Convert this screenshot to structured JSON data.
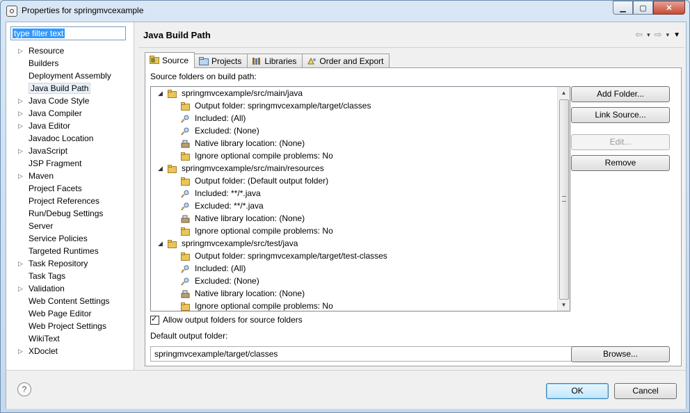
{
  "window": {
    "title": "Properties for springmvcexample",
    "minimize": "▁",
    "maximize": "▢",
    "close": "✕"
  },
  "filter": {
    "value": "type filter text"
  },
  "tree": [
    {
      "label": "Resource",
      "expandable": true
    },
    {
      "label": "Builders",
      "expandable": false
    },
    {
      "label": "Deployment Assembly",
      "expandable": false
    },
    {
      "label": "Java Build Path",
      "expandable": false,
      "selected": true
    },
    {
      "label": "Java Code Style",
      "expandable": true
    },
    {
      "label": "Java Compiler",
      "expandable": true
    },
    {
      "label": "Java Editor",
      "expandable": true
    },
    {
      "label": "Javadoc Location",
      "expandable": false
    },
    {
      "label": "JavaScript",
      "expandable": true
    },
    {
      "label": "JSP Fragment",
      "expandable": false
    },
    {
      "label": "Maven",
      "expandable": true
    },
    {
      "label": "Project Facets",
      "expandable": false
    },
    {
      "label": "Project References",
      "expandable": false
    },
    {
      "label": "Run/Debug Settings",
      "expandable": false
    },
    {
      "label": "Server",
      "expandable": false
    },
    {
      "label": "Service Policies",
      "expandable": false
    },
    {
      "label": "Targeted Runtimes",
      "expandable": false
    },
    {
      "label": "Task Repository",
      "expandable": true
    },
    {
      "label": "Task Tags",
      "expandable": false
    },
    {
      "label": "Validation",
      "expandable": true
    },
    {
      "label": "Web Content Settings",
      "expandable": false
    },
    {
      "label": "Web Page Editor",
      "expandable": false
    },
    {
      "label": "Web Project Settings",
      "expandable": false
    },
    {
      "label": "WikiText",
      "expandable": false
    },
    {
      "label": "XDoclet",
      "expandable": true
    }
  ],
  "page": {
    "title": "Java Build Path",
    "nav": {
      "back": "⇦",
      "forward": "⇨",
      "dropdown": "▾",
      "menu": "▼"
    }
  },
  "tabs": [
    {
      "label": "Source",
      "icon": "source-folder-icon",
      "active": true
    },
    {
      "label": "Projects",
      "icon": "projects-icon",
      "active": false
    },
    {
      "label": "Libraries",
      "icon": "libraries-icon",
      "active": false
    },
    {
      "label": "Order and Export",
      "icon": "order-export-icon",
      "active": false
    }
  ],
  "source": {
    "section_label": "Source folders on build path:",
    "rows": [
      {
        "level": 0,
        "icon": "folder",
        "text": "springmvcexample/src/main/java"
      },
      {
        "level": 1,
        "icon": "folder",
        "text": "Output folder: springmvcexample/target/classes"
      },
      {
        "level": 1,
        "icon": "gear",
        "text": "Included: (All)"
      },
      {
        "level": 1,
        "icon": "gear",
        "text": "Excluded: (None)"
      },
      {
        "level": 1,
        "icon": "lib",
        "text": "Native library location: (None)"
      },
      {
        "level": 1,
        "icon": "folder",
        "text": "Ignore optional compile problems: No"
      },
      {
        "level": 0,
        "icon": "folder",
        "text": "springmvcexample/src/main/resources"
      },
      {
        "level": 1,
        "icon": "folder",
        "text": "Output folder: (Default output folder)"
      },
      {
        "level": 1,
        "icon": "gear",
        "text": "Included: **/*.java"
      },
      {
        "level": 1,
        "icon": "gear",
        "text": "Excluded: **/*.java"
      },
      {
        "level": 1,
        "icon": "lib",
        "text": "Native library location: (None)"
      },
      {
        "level": 1,
        "icon": "folder",
        "text": "Ignore optional compile problems: No"
      },
      {
        "level": 0,
        "icon": "folder",
        "text": "springmvcexample/src/test/java"
      },
      {
        "level": 1,
        "icon": "folder",
        "text": "Output folder: springmvcexample/target/test-classes"
      },
      {
        "level": 1,
        "icon": "gear",
        "text": "Included: (All)"
      },
      {
        "level": 1,
        "icon": "gear",
        "text": "Excluded: (None)"
      },
      {
        "level": 1,
        "icon": "lib",
        "text": "Native library location: (None)"
      },
      {
        "level": 1,
        "icon": "folder",
        "text": "Ignore optional compile problems: No"
      }
    ],
    "buttons": {
      "add_folder": "Add Folder...",
      "link_source": "Link Source...",
      "edit": "Edit...",
      "remove": "Remove"
    },
    "allow_output_label": "Allow output folders for source folders",
    "allow_output_checked": true,
    "default_output_label": "Default output folder:",
    "default_output_value": "springmvcexample/target/classes",
    "browse": "Browse..."
  },
  "footer": {
    "help": "?",
    "ok": "OK",
    "cancel": "Cancel"
  }
}
